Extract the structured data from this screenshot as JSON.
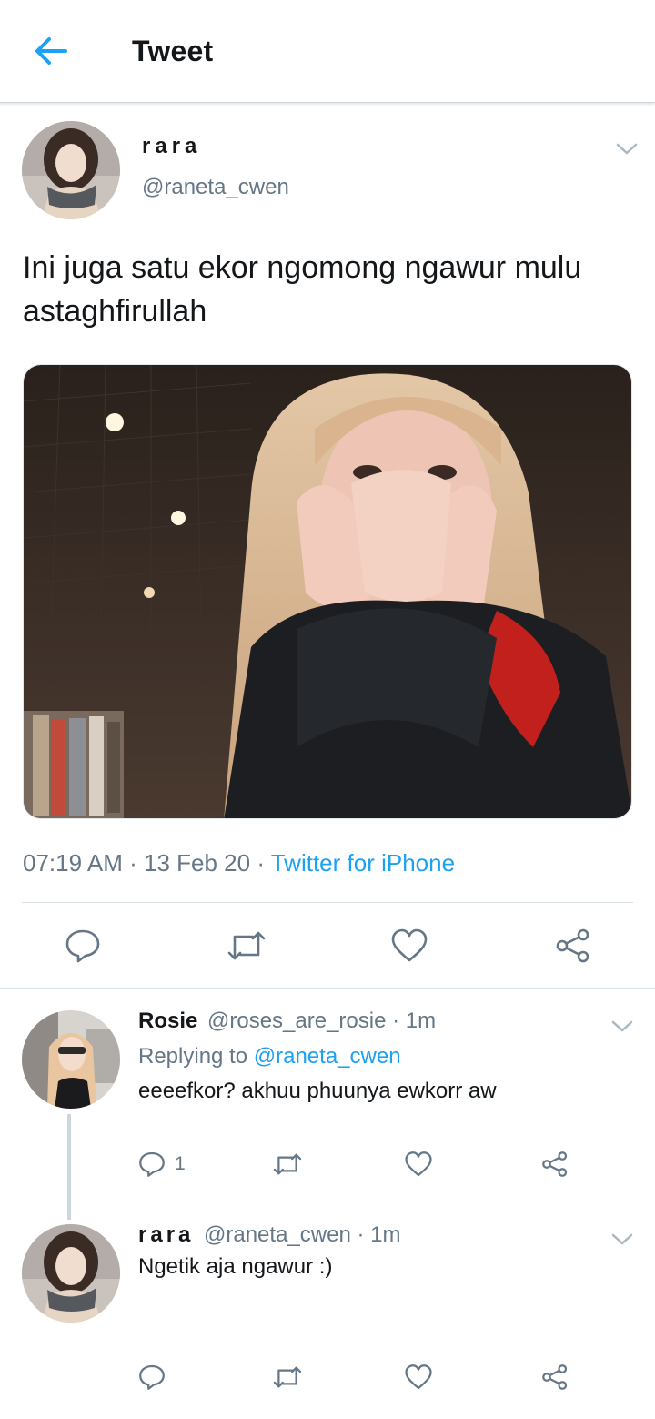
{
  "header": {
    "title": "Tweet",
    "back_icon": "arrow-left-icon"
  },
  "main_tweet": {
    "display_name": "rara",
    "handle": "@raneta_cwen",
    "text": "Ini juga satu ekor ngomong ngawur mulu astaghfirullah",
    "time": "07:19 AM",
    "date": "13 Feb 20",
    "source": "Twitter for iPhone"
  },
  "replies": [
    {
      "display_name": "Rosie",
      "handle": "@roses_are_rosie",
      "time": "1m",
      "replying_prefix": "Replying to ",
      "replying_to": "@raneta_cwen",
      "text": "eeeefkor? akhuu phuunya ewkorr aw",
      "reply_count": "1"
    },
    {
      "display_name": "rara",
      "handle": "@raneta_cwen",
      "time": "1m",
      "text": "Ngetik aja ngawur :)"
    }
  ],
  "colors": {
    "accent": "#1da1f2",
    "secondary_text": "#657786",
    "icon_gray": "#657786"
  }
}
